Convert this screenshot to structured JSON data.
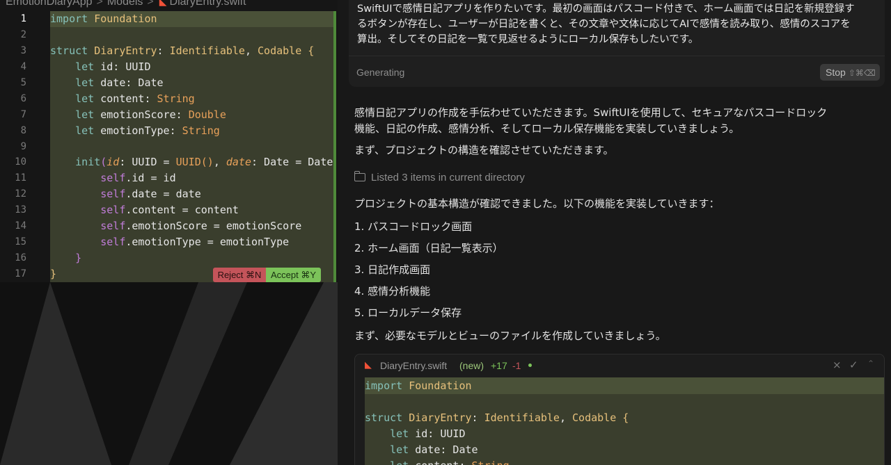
{
  "editor": {
    "breadcrumb": [
      "EmotionDiaryApp",
      "Models",
      "DiaryEntry.swift"
    ],
    "line_numbers": [
      "1",
      "2",
      "3",
      "4",
      "5",
      "6",
      "7",
      "8",
      "9",
      "10",
      "11",
      "12",
      "13",
      "14",
      "15",
      "16",
      "17"
    ],
    "reject_label": "Reject ⌘N",
    "accept_label": "Accept ⌘Y",
    "code": {
      "l1_kw": "import",
      "l1_ty": "Foundation",
      "l3_kw": "struct",
      "l3_name": "DiaryEntry",
      "l3_colon": ": ",
      "l3_p1": "Identifiable",
      "l3_comma": ", ",
      "l3_p2": "Codable",
      "l3_brace": " {",
      "l4_kw": "let",
      "l4_rest": " id: UUID",
      "l5_kw": "let",
      "l5_rest": " date: Date",
      "l6_kw": "let",
      "l6_rest": " content: ",
      "l6_ty": "String",
      "l7_kw": "let",
      "l7_rest": " emotionScore: ",
      "l7_ty": "Double",
      "l8_kw": "let",
      "l8_rest": " emotionType: ",
      "l8_ty": "String",
      "l10_kw": "init",
      "l10_p": "(",
      "l10_a1": "id",
      "l10_t1": ": UUID = ",
      "l10_f": "UUID()",
      "l10_c": ", ",
      "l10_a2": "date",
      "l10_t2": ": Date = Date",
      "l11_self": "self",
      "l11_rest": ".id = id",
      "l12_self": "self",
      "l12_rest": ".date = date",
      "l13_self": "self",
      "l13_rest": ".content = content",
      "l14_self": "self",
      "l14_rest": ".emotionScore = emotionScore",
      "l15_self": "self",
      "l15_rest": ".emotionType = emotionType",
      "l16": "}",
      "l17": "}"
    }
  },
  "chat": {
    "prompt_line1": "SwiftUIで感情日記アプリを作りたいです。最初の画面はパスコード付きで、ホーム画面では日記を新規登録す",
    "prompt_line2": "るボタンが存在し、ユーザーが日記を書くと、その文章や文体に応じてAIで感情を読み取り、感情のスコアを",
    "prompt_line3": "算出。そしてその日記を一覧で見返せるようにローカル保存もしたいです。",
    "status": "Generating",
    "stop_label": "Stop",
    "stop_shortcut": "⇧⌘⌫",
    "intro_line1": "感情日記アプリの作成を手伝わせていただきます。SwiftUIを使用して、セキュアなパスコードロック",
    "intro_line2": "機能、日記の作成、感情分析、そしてローカル保存機能を実装していきましょう。",
    "intro_line3": "まず、プロジェクトの構造を確認させていただきます。",
    "tool_result": "Listed 3 items in current directory",
    "structure_text": "プロジェクトの基本構造が確認できました。以下の機能を実装していきます：",
    "features": [
      "1. パスコードロック画面",
      "2. ホーム画面（日記一覧表示）",
      "3. 日記作成画面",
      "4. 感情分析機能",
      "5. ローカルデータ保存"
    ],
    "next_text": "まず、必要なモデルとビューのファイルを作成していきましょう。",
    "file": {
      "name": "DiaryEntry.swift",
      "status": "(new)",
      "added": "+17",
      "removed": "-1",
      "close_glyph": "×",
      "check_glyph": "✓",
      "expand_glyph": "⌃",
      "l1_kw": "import",
      "l1_ty": "Foundation",
      "l3_kw": "struct",
      "l3_name": "DiaryEntry",
      "l3_colon": ": ",
      "l3_p1": "Identifiable",
      "l3_comma": ", ",
      "l3_p2": "Codable",
      "l3_brace": " {",
      "l4_kw": "let",
      "l4_rest": " id: UUID",
      "l5_kw": "let",
      "l5_rest": " date: Date",
      "l6_kw": "let",
      "l6_rest": " content: ",
      "l6_ty": "String"
    }
  }
}
